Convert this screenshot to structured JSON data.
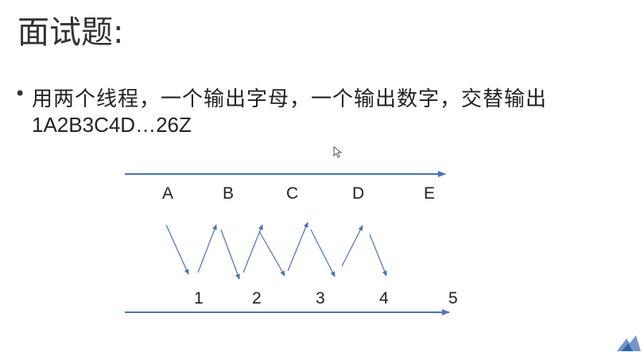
{
  "slide": {
    "title": "面试题:",
    "bullet": {
      "symbol": "•",
      "line1": "用两个线程，一个输出字母，一个输出数字，交替输出",
      "line2": "1A2B3C4D…26Z"
    }
  },
  "diagram": {
    "top_labels": [
      "A",
      "B",
      "C",
      "D",
      "E"
    ],
    "bottom_labels": [
      "1",
      "2",
      "3",
      "4",
      "5"
    ],
    "arrow_color": "#4a72b8"
  },
  "icons": {
    "cursor": "mouse-pointer-icon",
    "corner": "logo-icon"
  }
}
